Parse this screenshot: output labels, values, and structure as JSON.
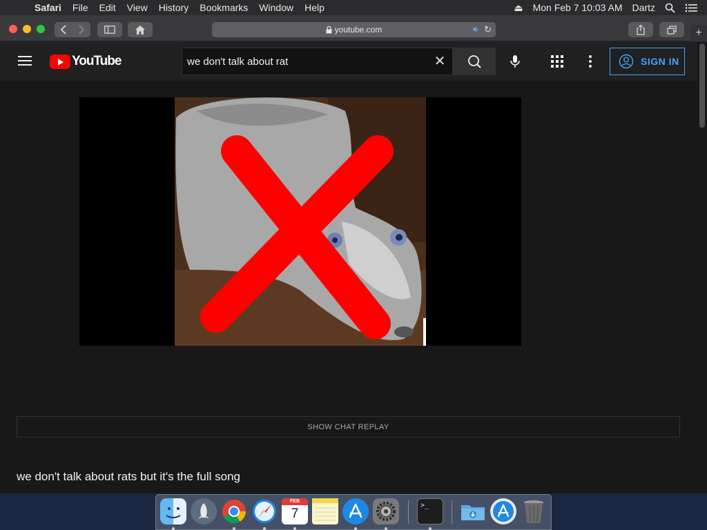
{
  "menubar": {
    "items": [
      "Safari",
      "File",
      "Edit",
      "View",
      "History",
      "Bookmarks",
      "Window",
      "Help"
    ],
    "clock": "Mon Feb 7  10:03 AM",
    "user": "Dartz"
  },
  "safari": {
    "url": "youtube.com",
    "new_tab": "+"
  },
  "youtube": {
    "logo_text": "YouTube",
    "search_value": "we don't talk about rat",
    "sign_in_label": "SIGN IN",
    "chat_replay_label": "SHOW CHAT REPLAY",
    "video_title": "we don't talk about rats but it's the full song"
  },
  "dock": {
    "calendar_month": "FEB",
    "calendar_day": "7",
    "terminal_prompt": ">_",
    "apps": [
      "finder-icon",
      "launchpad-icon",
      "chrome-icon",
      "safari-icon",
      "calendar-icon",
      "notes-icon",
      "app-store-icon",
      "system-preferences-icon",
      "terminal-icon",
      "downloads-folder-icon",
      "app-store-folder-icon",
      "trash-icon"
    ]
  },
  "colors": {
    "youtube_red": "#ff0000",
    "link_blue": "#3ea6ff",
    "page_bg": "#181818",
    "header_bg": "#202020"
  }
}
